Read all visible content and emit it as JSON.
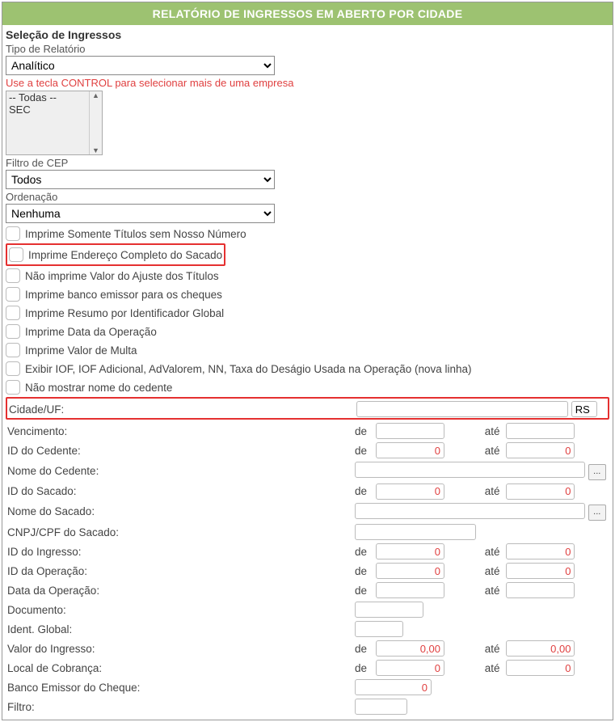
{
  "title": "RELATÓRIO DE INGRESSOS EM ABERTO POR CIDADE",
  "section_title": "Seleção de Ingressos",
  "tipo_relatorio": {
    "label": "Tipo de Relatório",
    "value": "Analítico"
  },
  "help_text": "Use a tecla CONTROL para selecionar mais de uma empresa",
  "empresas": {
    "items": [
      "-- Todas --",
      "SEC"
    ]
  },
  "filtro_cep": {
    "label": "Filtro de CEP",
    "value": "Todos"
  },
  "ordenacao": {
    "label": "Ordenação",
    "value": "Nenhuma"
  },
  "checkboxes": [
    "Imprime Somente Títulos sem Nosso Número",
    "Imprime Endereço Completo do Sacado",
    "Não imprime Valor do Ajuste dos Títulos",
    "Imprime banco emissor para os cheques",
    "Imprime Resumo por Identificador Global",
    "Imprime Data da Operação",
    "Imprime Valor de Multa",
    "Exibir IOF, IOF Adicional, AdValorem, NN, Taxa do Deságio Usada na Operação (nova linha)",
    "Não mostrar nome do cedente"
  ],
  "rows": {
    "cidade_uf": {
      "label": "Cidade/UF:",
      "cidade": "",
      "uf": "RS"
    },
    "vencimento": {
      "label": "Vencimento:",
      "de": "de",
      "ate": "até",
      "v1": "",
      "v2": ""
    },
    "id_cedente": {
      "label": "ID do Cedente:",
      "de": "de",
      "ate": "até",
      "v1": "0",
      "v2": "0"
    },
    "nome_cedente": {
      "label": "Nome do Cedente:",
      "v": ""
    },
    "id_sacado": {
      "label": "ID do Sacado:",
      "de": "de",
      "ate": "até",
      "v1": "0",
      "v2": "0"
    },
    "nome_sacado": {
      "label": "Nome do Sacado:",
      "v": ""
    },
    "cnpj_cpf": {
      "label": "CNPJ/CPF do Sacado:",
      "v": ""
    },
    "id_ingresso": {
      "label": "ID do Ingresso:",
      "de": "de",
      "ate": "até",
      "v1": "0",
      "v2": "0"
    },
    "id_operacao": {
      "label": "ID da Operação:",
      "de": "de",
      "ate": "até",
      "v1": "0",
      "v2": "0"
    },
    "data_operacao": {
      "label": "Data da Operação:",
      "de": "de",
      "ate": "até",
      "v1": "",
      "v2": ""
    },
    "documento": {
      "label": "Documento:",
      "v": ""
    },
    "ident_global": {
      "label": "Ident. Global:",
      "v": ""
    },
    "valor_ingresso": {
      "label": "Valor do Ingresso:",
      "de": "de",
      "ate": "até",
      "v1": "0,00",
      "v2": "0,00"
    },
    "local_cobranca": {
      "label": "Local de Cobrança:",
      "de": "de",
      "ate": "até",
      "v1": "0",
      "v2": "0"
    },
    "banco_emissor": {
      "label": "Banco Emissor do Cheque:",
      "v": "0"
    },
    "filtro": {
      "label": "Filtro:",
      "v": ""
    },
    "ellipsis": "..."
  }
}
